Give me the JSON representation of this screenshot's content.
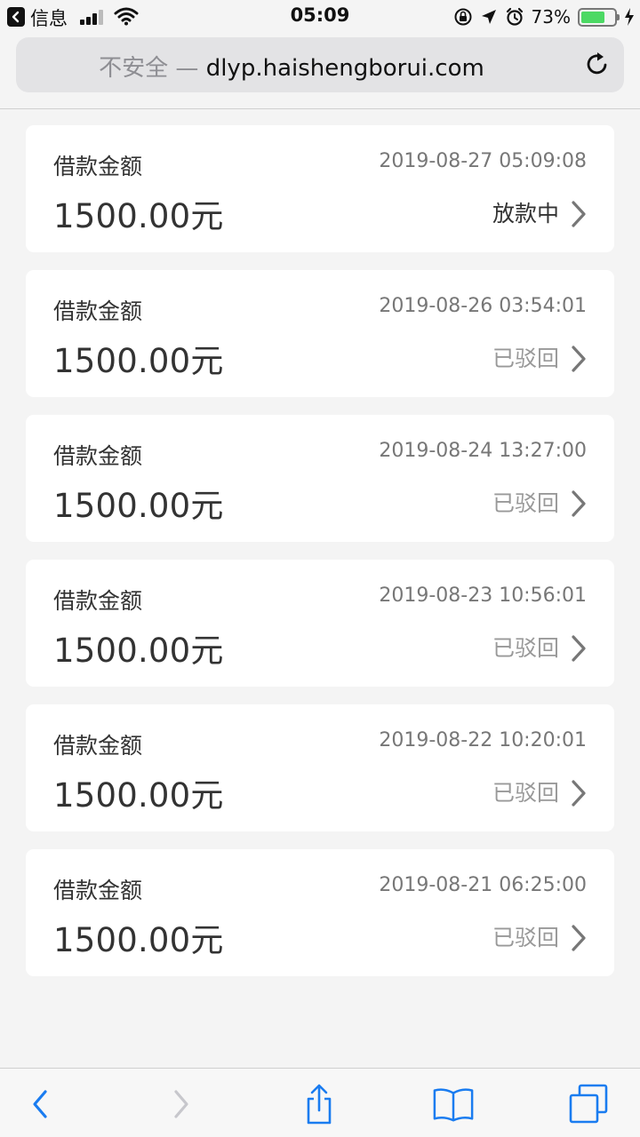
{
  "status_bar": {
    "back_app": "信息",
    "time": "05:09",
    "battery_percent": "73%",
    "battery_level": 0.73
  },
  "url_bar": {
    "insecure_label": "不安全 —",
    "domain": "dlyp.haishengborui.com"
  },
  "loans": [
    {
      "label": "借款金额",
      "amount": "1500.00元",
      "datetime": "2019-08-27 05:09:08",
      "status": "放款中",
      "status_type": "active"
    },
    {
      "label": "借款金额",
      "amount": "1500.00元",
      "datetime": "2019-08-26 03:54:01",
      "status": "已驳回",
      "status_type": "rejected"
    },
    {
      "label": "借款金额",
      "amount": "1500.00元",
      "datetime": "2019-08-24 13:27:00",
      "status": "已驳回",
      "status_type": "rejected"
    },
    {
      "label": "借款金额",
      "amount": "1500.00元",
      "datetime": "2019-08-23 10:56:01",
      "status": "已驳回",
      "status_type": "rejected"
    },
    {
      "label": "借款金额",
      "amount": "1500.00元",
      "datetime": "2019-08-22 10:20:01",
      "status": "已驳回",
      "status_type": "rejected"
    },
    {
      "label": "借款金额",
      "amount": "1500.00元",
      "datetime": "2019-08-21 06:25:00",
      "status": "已驳回",
      "status_type": "rejected"
    }
  ],
  "toolbar": {
    "icons": [
      "back-icon",
      "forward-icon",
      "share-icon",
      "bookmarks-icon",
      "tabs-icon"
    ],
    "accent_color": "#1a7cf0",
    "disabled_color": "#c7c7cc"
  }
}
